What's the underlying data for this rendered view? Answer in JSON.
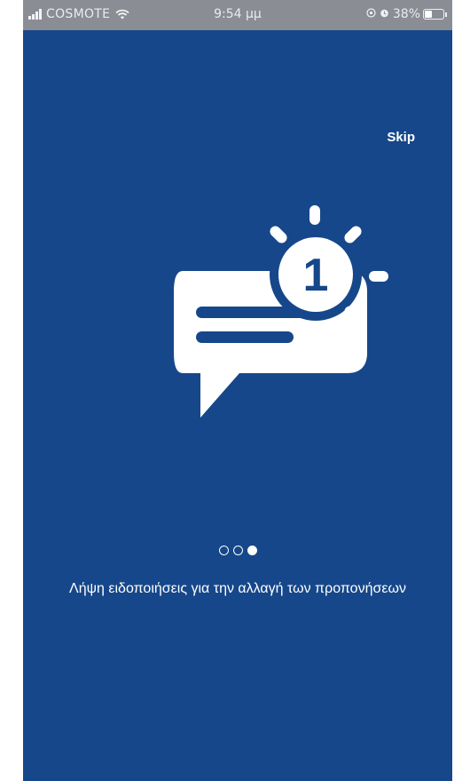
{
  "status_bar": {
    "carrier": "COSMOTE",
    "time": "9:54 μμ",
    "battery": "38%",
    "battery_level": 0.38,
    "icons": [
      "signal-icon",
      "wifi-icon",
      "location-icon",
      "alarm-icon",
      "battery-icon"
    ]
  },
  "onboarding": {
    "skip_label": "Skip",
    "illustration": "notification-chat-icon",
    "badge_count": "1",
    "page_count": 3,
    "current_page": 3,
    "caption": "Λήψη ειδοποιήσεις για την αλλαγή των προπονήσεων"
  },
  "colors": {
    "background": "#16478a",
    "status_bar": "#8a8d93",
    "foreground": "#ffffff"
  }
}
